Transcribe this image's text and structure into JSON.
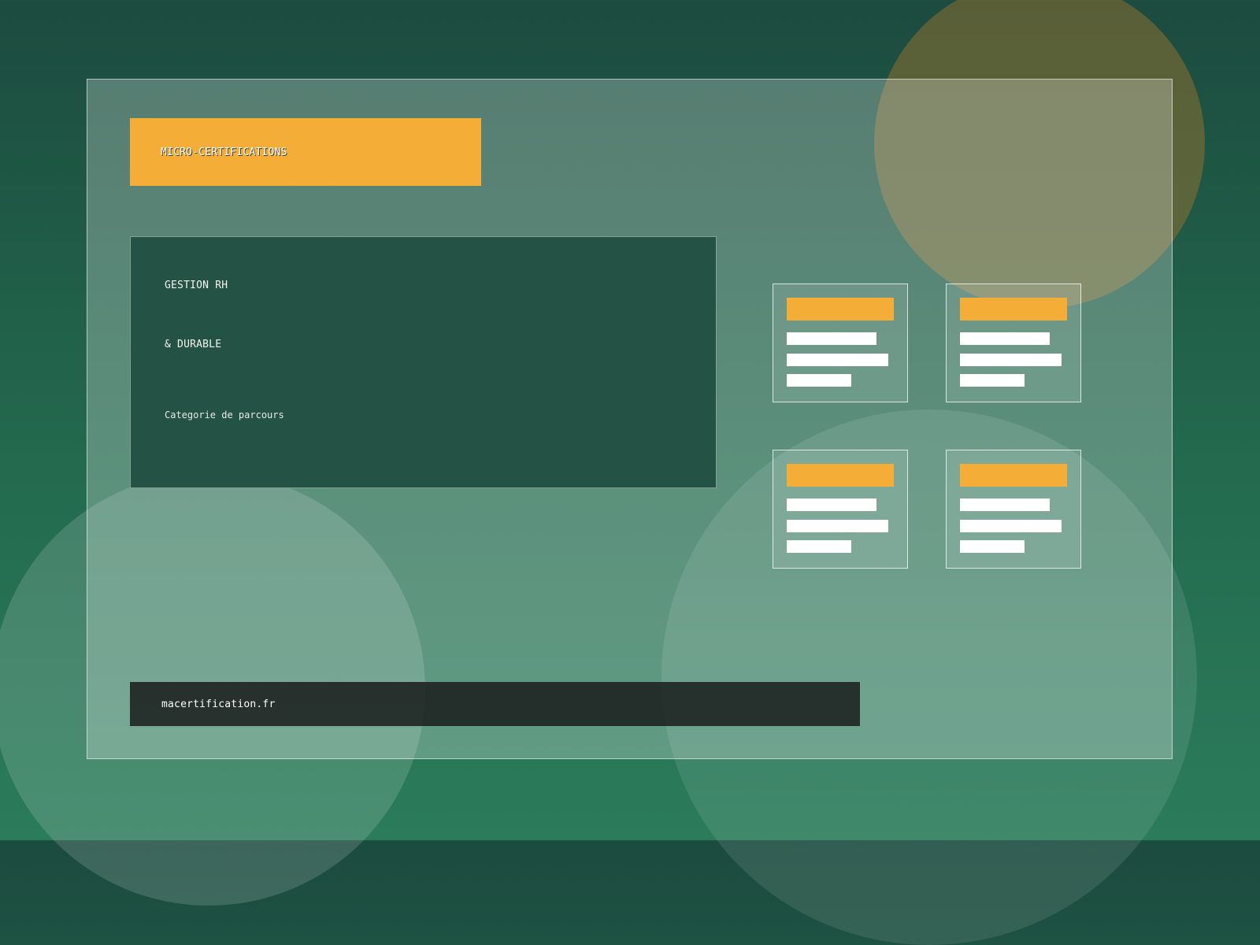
{
  "brand": {
    "label": "MICRO-CERTIFICATIONS"
  },
  "category": {
    "title_line_1": "GESTION RH",
    "title_line_2": "& DURABLE",
    "caption": "Categorie de parcours"
  },
  "footer": {
    "site": "macertification.fr"
  },
  "colors": {
    "accent": "#f4ad36",
    "background_top": "#1c4b3f",
    "background_bottom": "#2b7c5b",
    "card": "#245244",
    "footer": "#222f2b"
  },
  "preview_cards": [
    {
      "name": "preview-card-1"
    },
    {
      "name": "preview-card-2"
    },
    {
      "name": "preview-card-3"
    },
    {
      "name": "preview-card-4"
    }
  ]
}
